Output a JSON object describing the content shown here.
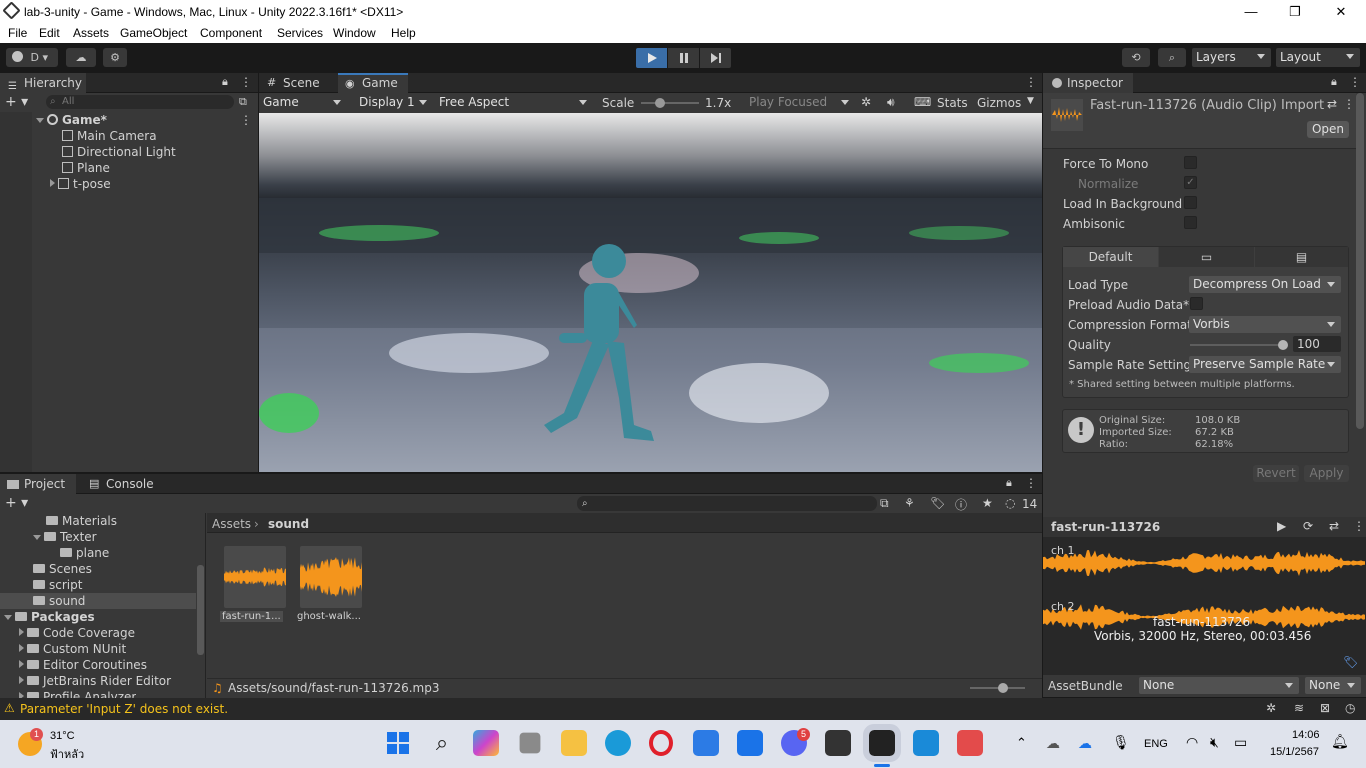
{
  "window": {
    "title": "lab-3-unity - Game - Windows, Mac, Linux - Unity 2022.3.16f1* <DX11>",
    "controls": [
      "—",
      "❐",
      "✕"
    ]
  },
  "menu": [
    "File",
    "Edit",
    "Assets",
    "GameObject",
    "Component",
    "Services",
    "Window",
    "Help"
  ],
  "toolbar": {
    "account": "D",
    "layers": "Layers",
    "layout": "Layout"
  },
  "hierarchy": {
    "tab": "Hierarchy",
    "search_placeholder": "All",
    "scene": "Game*",
    "items": [
      "Main Camera",
      "Directional Light",
      "Plane",
      "t-pose"
    ]
  },
  "game_view": {
    "tabs": [
      "Scene",
      "Game"
    ],
    "mode": "Game",
    "display": "Display 1",
    "aspect": "Free Aspect",
    "scale_label": "Scale",
    "scale_value": "1.7x",
    "play_focused": "Play Focused",
    "stats": "Stats",
    "gizmos": "Gizmos"
  },
  "inspector": {
    "tab": "Inspector",
    "asset_title": "Fast-run-113726 (Audio Clip) Import",
    "open_label": "Open",
    "options": [
      {
        "label": "Force To Mono",
        "checked": false
      },
      {
        "label": "Normalize",
        "checked": true,
        "disabled": true
      },
      {
        "label": "Load In Background",
        "checked": false
      },
      {
        "label": "Ambisonic",
        "checked": false
      }
    ],
    "platform_tab": "Default",
    "settings": {
      "load_type_label": "Load Type",
      "load_type": "Decompress On Load",
      "preload_label": "Preload Audio Data*",
      "compression_label": "Compression Format",
      "compression": "Vorbis",
      "quality_label": "Quality",
      "quality": "100",
      "sample_rate_label": "Sample Rate Setting",
      "sample_rate": "Preserve Sample Rate",
      "note": "* Shared setting between multiple platforms."
    },
    "info": {
      "original_label": "Original Size:",
      "original": "108.0 KB",
      "imported_label": "Imported Size:",
      "imported": "67.2 KB",
      "ratio_label": "Ratio:",
      "ratio": "62.18%"
    },
    "revert": "Revert",
    "apply": "Apply"
  },
  "preview": {
    "name": "fast-run-113726",
    "ch1": "ch 1",
    "ch2": "ch 2",
    "overlay": "fast-run-113726",
    "details": "Vorbis, 32000 Hz, Stereo, 00:03.456",
    "assetbundle_label": "AssetBundle",
    "bundle": "None",
    "variant": "None",
    "waveform_color": "#f4951c"
  },
  "project": {
    "tabs": [
      "Project",
      "Console"
    ],
    "hidden_count": "14",
    "tree": [
      {
        "label": "Materials",
        "indent": 1
      },
      {
        "label": "Texter",
        "indent": 1,
        "expanded": true
      },
      {
        "label": "plane",
        "indent": 2
      },
      {
        "label": "Scenes",
        "indent": 1
      },
      {
        "label": "script",
        "indent": 1
      },
      {
        "label": "sound",
        "indent": 1,
        "selected": true
      },
      {
        "label": "Packages",
        "indent": 0,
        "expanded": true,
        "bold": true
      },
      {
        "label": "Code Coverage",
        "indent": 1
      },
      {
        "label": "Custom NUnit",
        "indent": 1
      },
      {
        "label": "Editor Coroutines",
        "indent": 1
      },
      {
        "label": "JetBrains Rider Editor",
        "indent": 1
      },
      {
        "label": "Profile Analyzer",
        "indent": 1
      }
    ],
    "breadcrumb": [
      "Assets",
      "sound"
    ],
    "assets": [
      "fast-run-1...",
      "ghost-walk..."
    ],
    "path": "Assets/sound/fast-run-113726.mp3"
  },
  "status": {
    "warning": "Parameter 'Input Z' does not exist."
  },
  "taskbar": {
    "weather_temp": "31°C",
    "weather_desc": "ฟ้าหลัว",
    "weather_badge": "1",
    "discord_badge": "5",
    "lang": "ENG",
    "time": "14:06",
    "date": "15/1/2567"
  }
}
